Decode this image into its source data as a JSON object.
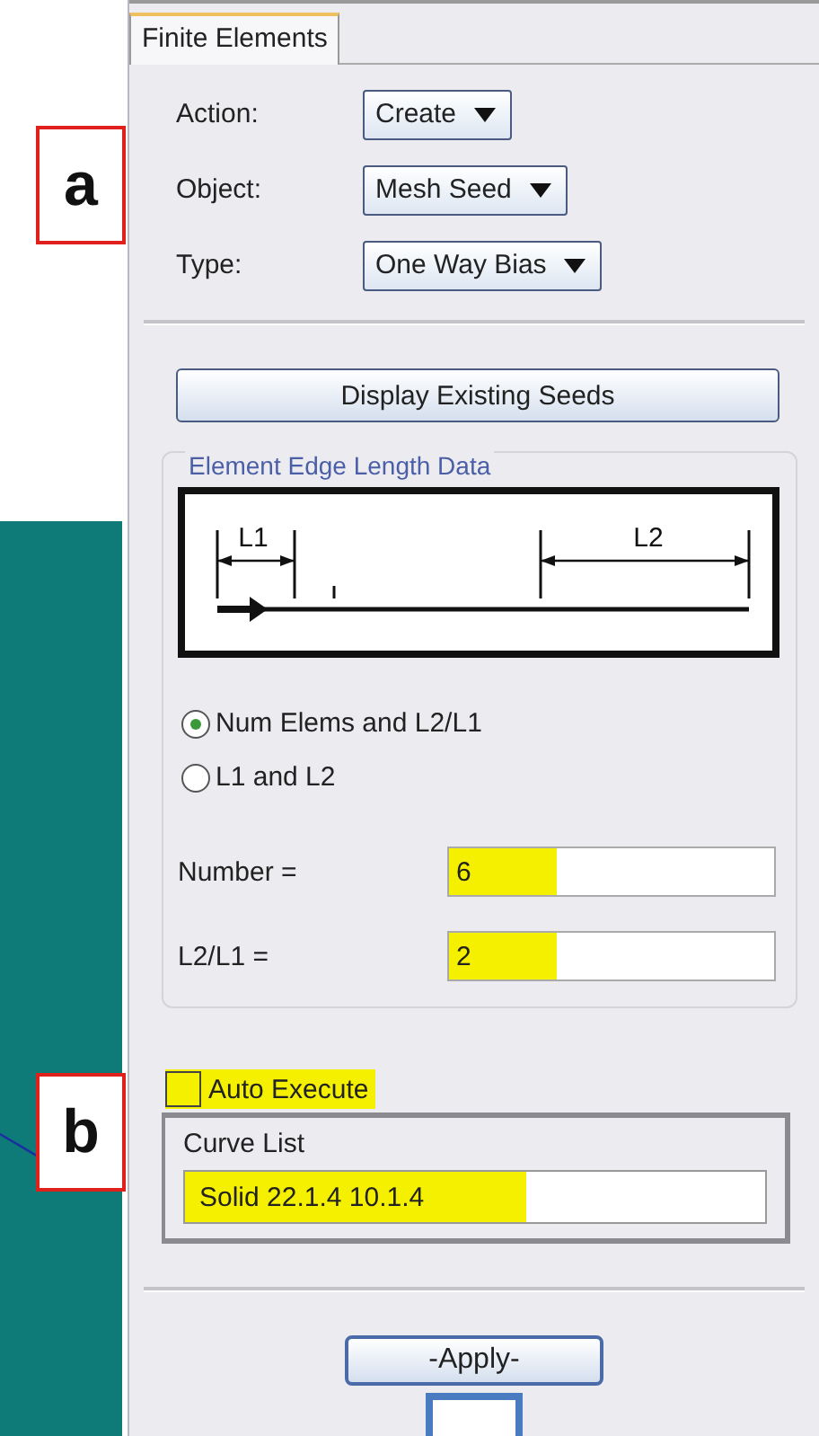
{
  "tab": {
    "label": "Finite Elements",
    "selected": true
  },
  "selectors": [
    {
      "label": "Action:",
      "value": "Create"
    },
    {
      "label": "Object:",
      "value": "Mesh Seed"
    },
    {
      "label": "Type:",
      "value": "One Way Bias"
    }
  ],
  "display_button": "Display Existing Seeds",
  "edge_group": {
    "title": "Element Edge Length Data",
    "diagram_labels": [
      "L1",
      "L2"
    ],
    "options": [
      {
        "label": "Num Elems and L2/L1",
        "selected": true
      },
      {
        "label": "L1 and L2",
        "selected": false
      }
    ],
    "fields": [
      {
        "label": "Number =",
        "value": "6",
        "highlighted": true
      },
      {
        "label": "L2/L1  =",
        "value": "2",
        "highlighted": true
      }
    ]
  },
  "auto_execute": {
    "label": "Auto Execute",
    "checked": false,
    "highlighted": true
  },
  "curve_list": {
    "title": "Curve List",
    "value": "Solid 22.1.4 10.1.4",
    "highlighted": true
  },
  "apply_button": "-Apply-",
  "callouts": [
    "a",
    "b"
  ]
}
